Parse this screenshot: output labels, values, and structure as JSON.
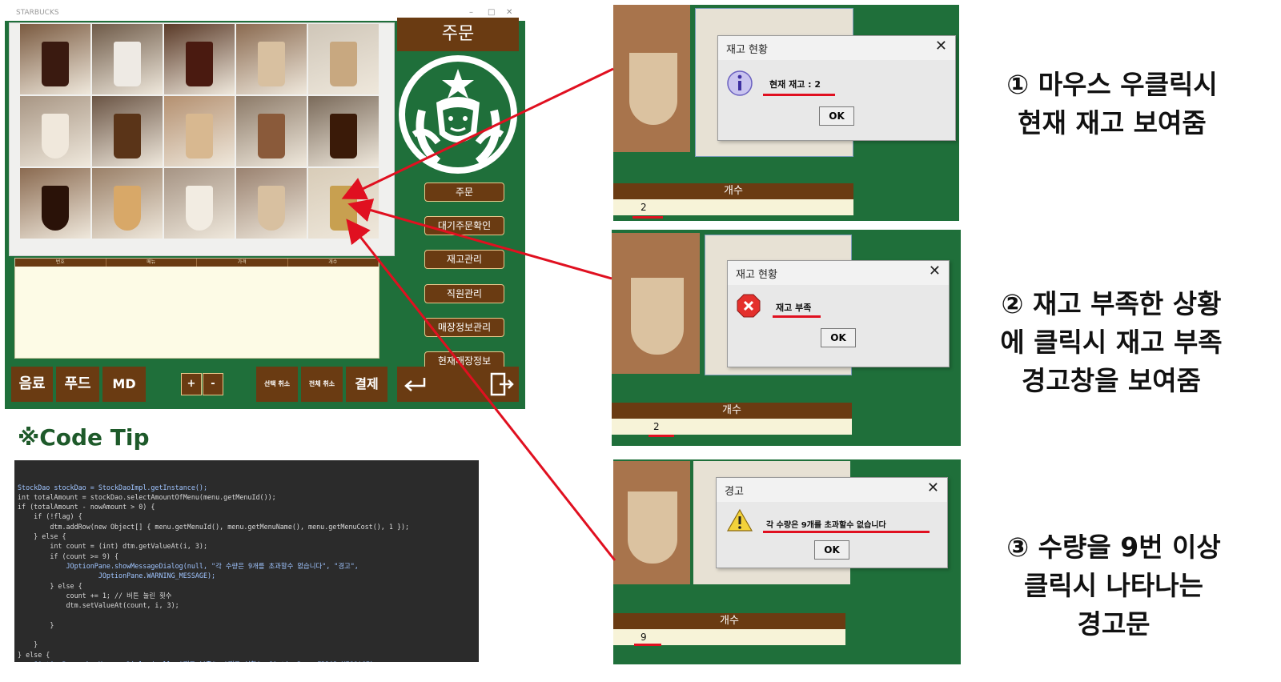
{
  "app": {
    "window_title": "STARBUCKS",
    "order_title": "주문",
    "grid_items": [
      {
        "name": "cold-brew"
      },
      {
        "name": "vanilla-frappuccino"
      },
      {
        "name": "iced-americano"
      },
      {
        "name": "iced-latte"
      },
      {
        "name": "iced-caramel-latte"
      },
      {
        "name": "cappuccino-mug"
      },
      {
        "name": "affogato"
      },
      {
        "name": "caramel-latte"
      },
      {
        "name": "mocha-frappuccino"
      },
      {
        "name": "coffee-jar"
      },
      {
        "name": "americano-cup"
      },
      {
        "name": "caramel-macchiato"
      },
      {
        "name": "flat-white"
      },
      {
        "name": "latte-mug"
      },
      {
        "name": "gift-bottle"
      }
    ],
    "table_headers": [
      "번호",
      "메뉴",
      "가격",
      "개수"
    ],
    "right_buttons": [
      "주문",
      "대기주문확인",
      "재고관리",
      "직원관리",
      "매장정보관리",
      "현재매장정보"
    ],
    "bottom_buttons": {
      "drink": "음료",
      "food": "푸드",
      "md": "MD",
      "plus": "+",
      "minus": "-",
      "cancel_selected": "선택 취소",
      "cancel_all": "전체 취소",
      "pay": "결제"
    }
  },
  "code_tip": {
    "title": "※Code Tip",
    "lines": [
      "StockDao stockDao = StockDaoImpl.getInstance();",
      "int totalAmount = stockDao.selectAmountOfMenu(menu.getMenuId());",
      "if (totalAmount - nowAmount > 0) {",
      "    if (!flag) {",
      "        dtm.addRow(new Object[] { menu.getMenuId(), menu.getMenuName(), menu.getMenuCost(), 1 });",
      "    } else {",
      "        int count = (int) dtm.getValueAt(i, 3);",
      "        if (count >= 9) {",
      "            JOptionPane.showMessageDialog(null, \"각 수량은 9개를 초과할수 없습니다\", \"경고\",",
      "                    JOptionPane.WARNING_MESSAGE);",
      "        } else {",
      "            count += 1; // 버튼 눌린 횟수",
      "            dtm.setValueAt(count, i, 3);",
      "",
      "        }",
      "",
      "    }",
      "} else {",
      "    JOptionPane.showMessageDialog(null, \"재고 부족\", \"재고 현황\", JOptionPane.ERROR_MESSAGE);",
      "}"
    ]
  },
  "shots": [
    {
      "dialog_title": "재고 현황",
      "close": "✕",
      "message": "현재 재고 : 2",
      "ok": "OK",
      "icon": "info-icon",
      "count_header": "개수",
      "count_value": "2",
      "note": "① 마우스 우클릭시\n현재 재고 보여줌"
    },
    {
      "dialog_title": "재고 현황",
      "close": "✕",
      "message": "재고 부족",
      "ok": "OK",
      "icon": "error-icon",
      "count_header": "개수",
      "count_value": "2",
      "note": "② 재고 부족한 상황\n에 클릭시 재고 부족\n경고창을 보여줌"
    },
    {
      "dialog_title": "경고",
      "close": "✕",
      "message": "각 수량은 9개를 초과할수 없습니다",
      "ok": "OK",
      "icon": "warning-icon",
      "count_header": "개수",
      "count_value": "9",
      "note": "③ 수량을 9번 이상\n클릭시 나타나는\n경고문"
    }
  ],
  "colors": {
    "green": "#1f6f3a",
    "brown": "#6a3b12",
    "arrow": "#e01020"
  }
}
